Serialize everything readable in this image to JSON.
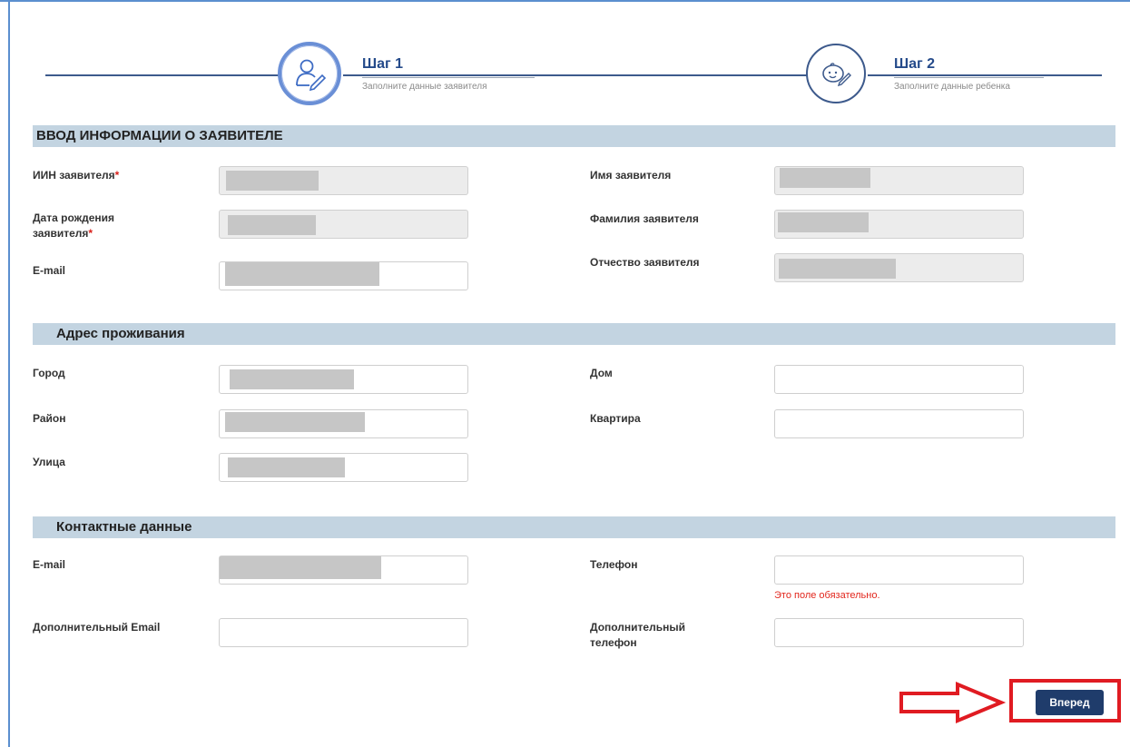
{
  "stepper": {
    "step1": {
      "title": "Шаг 1",
      "subtitle": "Заполните данные заявителя",
      "state": "active",
      "icon": "person-edit-icon"
    },
    "step2": {
      "title": "Шаг 2",
      "subtitle": "Заполните данные ребенка",
      "state": "inactive",
      "icon": "baby-edit-icon"
    }
  },
  "applicant": {
    "header": "ВВОД ИНФОРМАЦИИ О ЗАЯВИТЕЛЕ",
    "iin_label": "ИИН заявителя",
    "birthdate_label_line1": "Дата рождения",
    "birthdate_label_line2": "заявителя",
    "email_label": "E-mail",
    "firstname_label": "Имя заявителя",
    "lastname_label": "Фамилия заявителя",
    "patronymic_label": "Отчество заявителя",
    "required_mark": "*"
  },
  "address": {
    "header": "Адрес проживания",
    "city_label": "Город",
    "district_label": "Район",
    "street_label": "Улица",
    "house_label": "Дом",
    "apartment_label": "Квартира",
    "house_value": "",
    "apartment_value": ""
  },
  "contacts": {
    "header": "Контактные данные",
    "email_label": "E-mail",
    "extra_email_label": "Дополнительный Email",
    "phone_label": "Телефон",
    "extra_phone_label_line1": "Дополнительный",
    "extra_phone_label_line2": "телефон",
    "phone_error": "Это поле обязательно.",
    "extra_email_value": "",
    "phone_value": "",
    "extra_phone_value": ""
  },
  "actions": {
    "next_label": "Вперед",
    "annotation_color": "#e01b22",
    "annotation": "red-arrow-pointing-right"
  },
  "colors": {
    "section_bg": "#c3d4e1",
    "primary_button": "#1f3c6b",
    "step_accent": "#6a8fd6",
    "error": "#e2261c"
  }
}
